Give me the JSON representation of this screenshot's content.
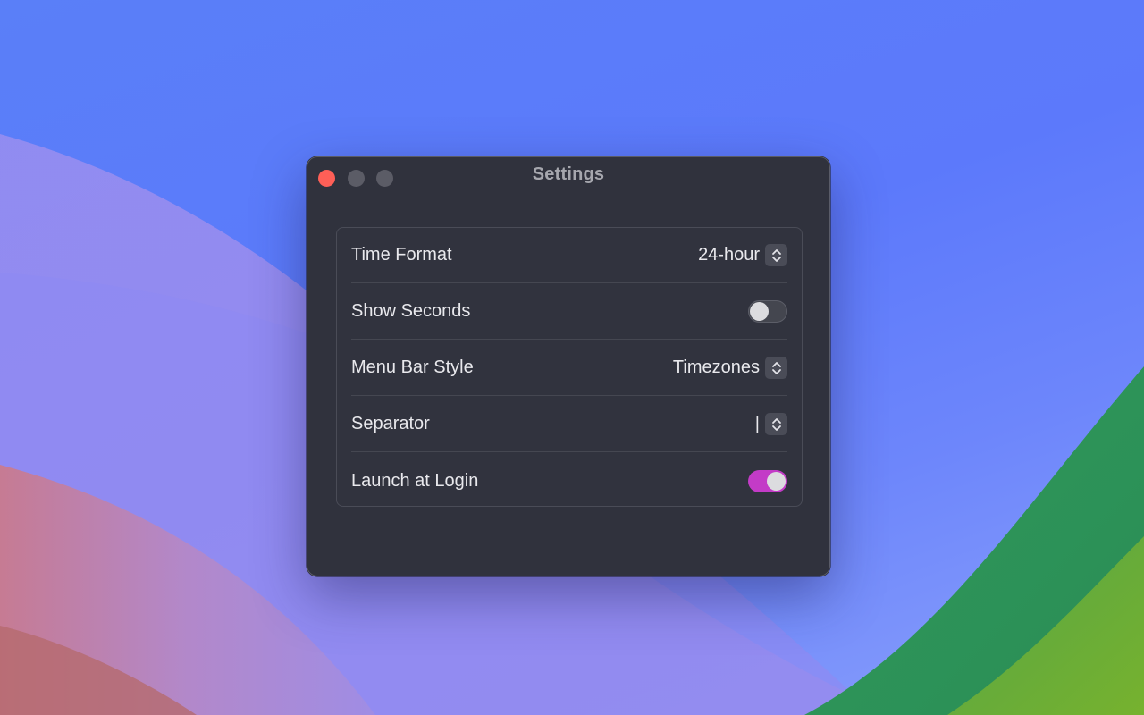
{
  "window": {
    "title": "Settings"
  },
  "settings": {
    "time_format": {
      "label": "Time Format",
      "value": "24-hour"
    },
    "show_seconds": {
      "label": "Show Seconds",
      "enabled": false
    },
    "menu_bar_style": {
      "label": "Menu Bar Style",
      "value": "Timezones"
    },
    "separator": {
      "label": "Separator",
      "value": "|"
    },
    "launch_at_login": {
      "label": "Launch at Login",
      "enabled": true
    }
  },
  "colors": {
    "close_button": "#fe5f57",
    "toggle_on": "#c33bc7",
    "window_bg": "#30323d"
  },
  "icons": {
    "popup_stepper": "chevron-up-down-icon"
  }
}
